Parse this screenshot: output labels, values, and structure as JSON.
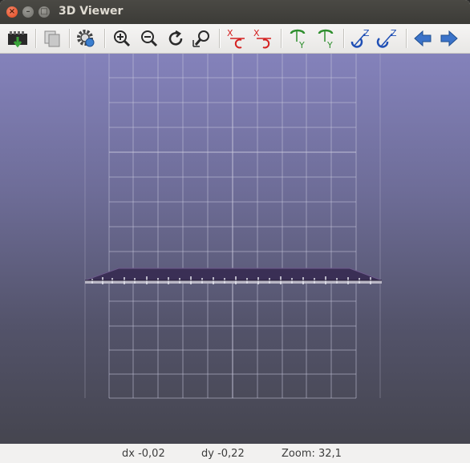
{
  "window": {
    "title": "3D Viewer",
    "close_glyph": "×",
    "min_glyph": "–",
    "max_glyph": "□"
  },
  "toolbar": {
    "buttons": [
      {
        "name": "reload-board-icon"
      },
      {
        "name": "copy-to-clipboard-icon"
      },
      {
        "name": "options-gear-icon"
      },
      {
        "name": "zoom-in-icon"
      },
      {
        "name": "zoom-out-icon"
      },
      {
        "name": "redraw-icon"
      },
      {
        "name": "zoom-fit-icon"
      },
      {
        "name": "rotate-x-cw-icon",
        "label_a": "X",
        "label_b": "C"
      },
      {
        "name": "rotate-x-ccw-icon",
        "label_a": "X",
        "label_b": "C"
      },
      {
        "name": "rotate-y-cw-icon",
        "label": "Y"
      },
      {
        "name": "rotate-y-ccw-icon",
        "label": "Y"
      },
      {
        "name": "rotate-z-cw-icon",
        "label": "Z"
      },
      {
        "name": "rotate-z-ccw-icon",
        "label": "Z"
      },
      {
        "name": "move-left-icon"
      },
      {
        "name": "move-right-icon"
      }
    ],
    "colors": {
      "zoom": "#2a2a2a",
      "x_rot": "#d42020",
      "y_rot": "#2f8f2f",
      "z_rot": "#1f4fb5",
      "arrows": "#3b73c9"
    }
  },
  "status": {
    "dx": "dx -0,02",
    "dy": "dy -0,22",
    "zoom": "Zoom: 32,1"
  },
  "viewport": {
    "grid_color": "#c9c8dc",
    "board_color": "#2e2a3a"
  }
}
